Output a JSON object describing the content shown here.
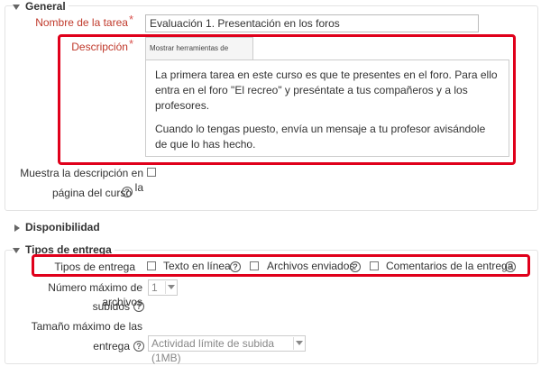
{
  "general": {
    "legend": "General",
    "task_name_label": "Nombre de la tarea",
    "task_name_value": "Evaluación 1. Presentación en los foros",
    "description_label": "Descripción",
    "editor_toolbar_label": "Mostrar herramientas de edición",
    "description_paragraphs": [
      "La primera tarea en este curso es que te presentes en el foro. Para ello entra en el foro \"El recreo\" y preséntate a tus compañeros y a los profesores.",
      "Cuando lo tengas puesto, envía un mensaje a tu profesor avisándole de que lo has hecho."
    ],
    "show_description_line1": "Muestra la descripción en la",
    "show_description_line2": "página del curso",
    "required_mark": "*",
    "help_glyph": "?"
  },
  "availability": {
    "legend": "Disponibilidad"
  },
  "submission": {
    "legend": "Tipos de entrega",
    "types_label": "Tipos de entrega",
    "options": [
      "Texto en línea",
      "Archivos enviados",
      "Comentarios de la entrega"
    ],
    "max_files_line1": "Número máximo de archivos",
    "max_files_line2": "subidos",
    "max_files_value": "1",
    "max_size_line1": "Tamaño máximo de las",
    "max_size_line2": "entrega",
    "max_size_value": "Actividad límite de subida (1MB)"
  },
  "colors": {
    "highlight": "#e0001b",
    "required": "#d9534f",
    "label_red": "#c0392b"
  }
}
